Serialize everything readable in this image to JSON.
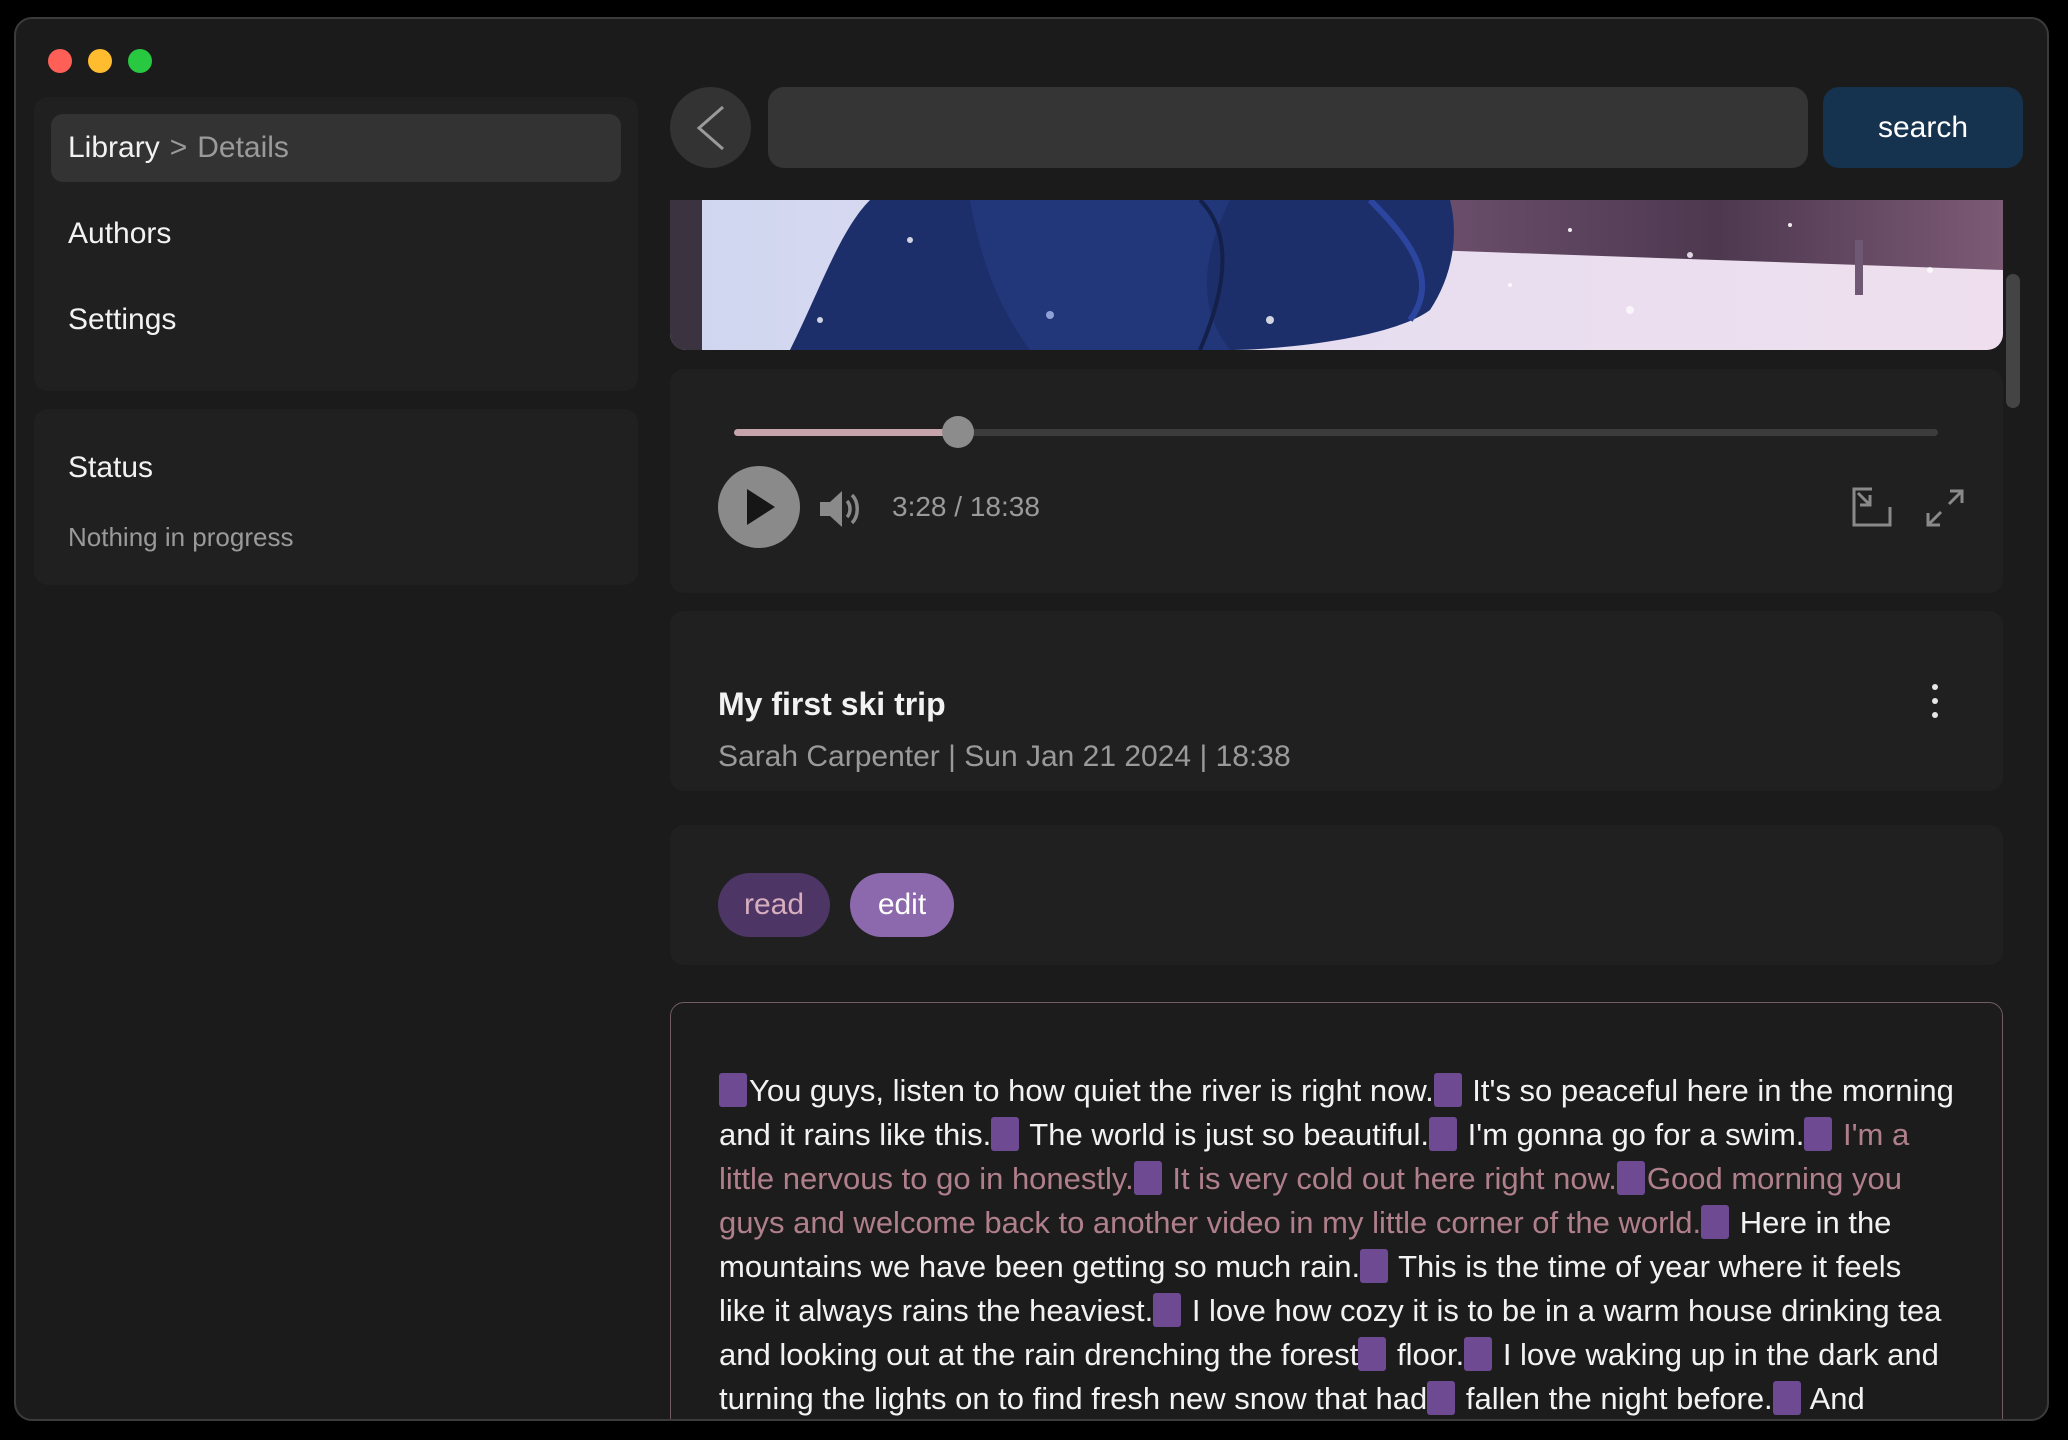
{
  "sidebar": {
    "breadcrumb": {
      "parent": "Library",
      "separator": ">",
      "current": "Details"
    },
    "items": [
      {
        "label": "Authors"
      },
      {
        "label": "Settings"
      }
    ]
  },
  "status": {
    "title": "Status",
    "message": "Nothing in progress"
  },
  "search": {
    "value": "",
    "button_label": "search"
  },
  "player": {
    "current_time": "3:28",
    "duration": "18:38",
    "time_display": "3:28 / 18:38",
    "progress": 0.186,
    "controls": [
      "play-icon",
      "volume-icon",
      "picture-in-picture-icon",
      "fullscreen-icon"
    ]
  },
  "recording": {
    "title": "My first ski trip",
    "meta": "Sarah Carpenter | Sun Jan 21 2024 | 18:38"
  },
  "modes": {
    "read_label": "read",
    "edit_label": "edit",
    "active": "edit"
  },
  "transcript": {
    "segments": [
      {
        "text": "You guys, listen to how quiet the river is right now.",
        "highlight": false
      },
      {
        "text": " It's so peaceful here in the morning and it rains like this.",
        "highlight": false
      },
      {
        "text": " The world is just so beautiful.",
        "highlight": false
      },
      {
        "text": " I'm gonna go for a swim.",
        "highlight": false
      },
      {
        "text": " I'm a little nervous to go in honestly.",
        "highlight": true
      },
      {
        "text": " It is very cold out here right now.",
        "highlight": true
      },
      {
        "text": "Good morning you guys and welcome back to another video in my little corner of the world.",
        "highlight": true
      },
      {
        "text": " Here in the mountains we have been getting so much rain.",
        "highlight": false
      },
      {
        "text": " This is the time of year where it feels like it always rains the heaviest.",
        "highlight": false
      },
      {
        "text": " I love how cozy it is to be in a warm house drinking tea and looking out at the rain drenching the forest",
        "highlight": false
      },
      {
        "text": " floor.",
        "highlight": false
      },
      {
        "text": " I love waking up in the dark and turning the lights on to find fresh new snow that had",
        "highlight": false
      },
      {
        "text": " fallen the night before.",
        "highlight": false
      },
      {
        "text": " And mostly I like how peaceful",
        "highlight": false
      }
    ]
  },
  "colors": {
    "window_bg": "#1b1b1b",
    "panel_bg": "#202020",
    "accent_search": "#15324f",
    "chip_read_bg": "#4d3565",
    "chip_edit_bg": "#8c68ad",
    "marker": "#6e4a92",
    "highlight_text": "#b07f8c"
  }
}
